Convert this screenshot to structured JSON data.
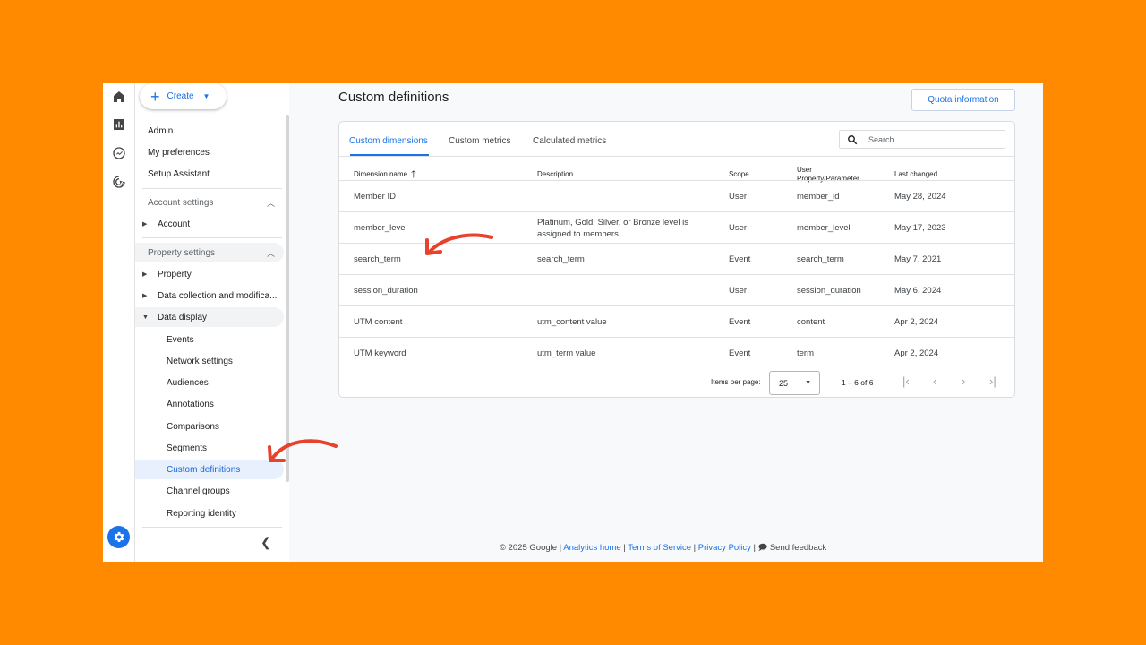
{
  "colors": {
    "background": "#FF8A00",
    "accent": "#1a73e8",
    "annotation": "#e8412c"
  },
  "rail": {
    "icons": [
      "home-icon",
      "reports-icon",
      "explore-icon",
      "advertising-icon"
    ],
    "settings_icon": "gear-icon"
  },
  "nav": {
    "create_label": "Create",
    "items": {
      "admin": "Admin",
      "preferences": "My preferences",
      "setup": "Setup Assistant",
      "account_settings": "Account settings",
      "account": "Account",
      "property_settings": "Property settings",
      "property": "Property",
      "data_collection": "Data collection and modifica...",
      "data_display": "Data display",
      "events": "Events",
      "network": "Network settings",
      "audiences": "Audiences",
      "annotations": "Annotations",
      "comparisons": "Comparisons",
      "segments": "Segments",
      "custom_definitions": "Custom definitions",
      "channel_groups": "Channel groups",
      "reporting_identity": "Reporting identity"
    },
    "collapse_icon": "chevron-left-icon"
  },
  "main": {
    "title": "Custom definitions",
    "quota_button": "Quota information",
    "tabs": [
      "Custom dimensions",
      "Custom metrics",
      "Calculated metrics"
    ],
    "search_placeholder": "Search",
    "columns": {
      "name": "Dimension name",
      "description": "Description",
      "scope": "Scope",
      "param_line1": "User",
      "param_line2": "Property/Parameter",
      "last_changed": "Last changed"
    },
    "rows": [
      {
        "name": "Member ID",
        "desc1": "",
        "desc2": "",
        "scope": "User",
        "param": "member_id",
        "date": "May 28, 2024"
      },
      {
        "name": "member_level",
        "desc1": "Platinum, Gold, Silver, or Bronze level is",
        "desc2": "assigned to members.",
        "scope": "User",
        "param": "member_level",
        "date": "May 17, 2023"
      },
      {
        "name": "search_term",
        "desc1": "search_term",
        "desc2": "",
        "scope": "Event",
        "param": "search_term",
        "date": "May 7, 2021"
      },
      {
        "name": "session_duration",
        "desc1": "",
        "desc2": "",
        "scope": "User",
        "param": "session_duration",
        "date": "May 6, 2024"
      },
      {
        "name": "UTM content",
        "desc1": "utm_content value",
        "desc2": "",
        "scope": "Event",
        "param": "content",
        "date": "Apr 2, 2024"
      },
      {
        "name": "UTM keyword",
        "desc1": "utm_term value",
        "desc2": "",
        "scope": "Event",
        "param": "term",
        "date": "Apr 2, 2024"
      }
    ],
    "pager": {
      "items_per_page_label": "Items per page:",
      "items_per_page": "25",
      "range": "1 – 6 of 6"
    }
  },
  "footer": {
    "copyright": "© 2025 Google |",
    "analytics_home": "Analytics home",
    "terms": "Terms of Service",
    "privacy": "Privacy Policy",
    "feedback": "Send feedback"
  }
}
